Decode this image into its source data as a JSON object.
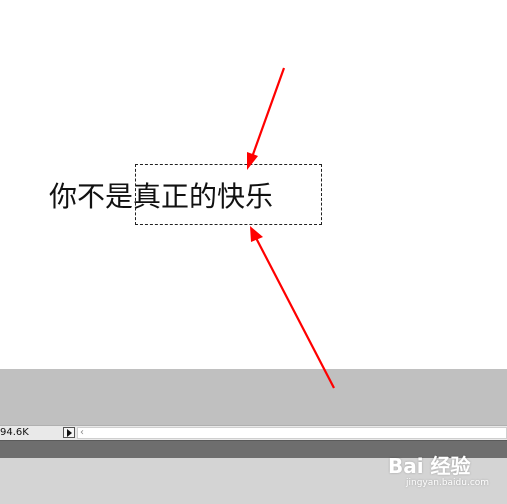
{
  "canvas": {
    "text": "你不是真正的快乐"
  },
  "status_bar": {
    "doc_size": "94.6K",
    "scroll_left_glyph": "‹"
  },
  "watermark": {
    "main": "Bai 经验",
    "sub": "jingyan.baidu.com"
  },
  "colors": {
    "annotation_arrow": "#ff0000",
    "pasteboard": "#c0c0c0",
    "bottom_bar": "#6e6e6e"
  },
  "icons": {
    "status_menu": "right-triangle-icon",
    "scroll_left": "chevron-left-icon"
  }
}
